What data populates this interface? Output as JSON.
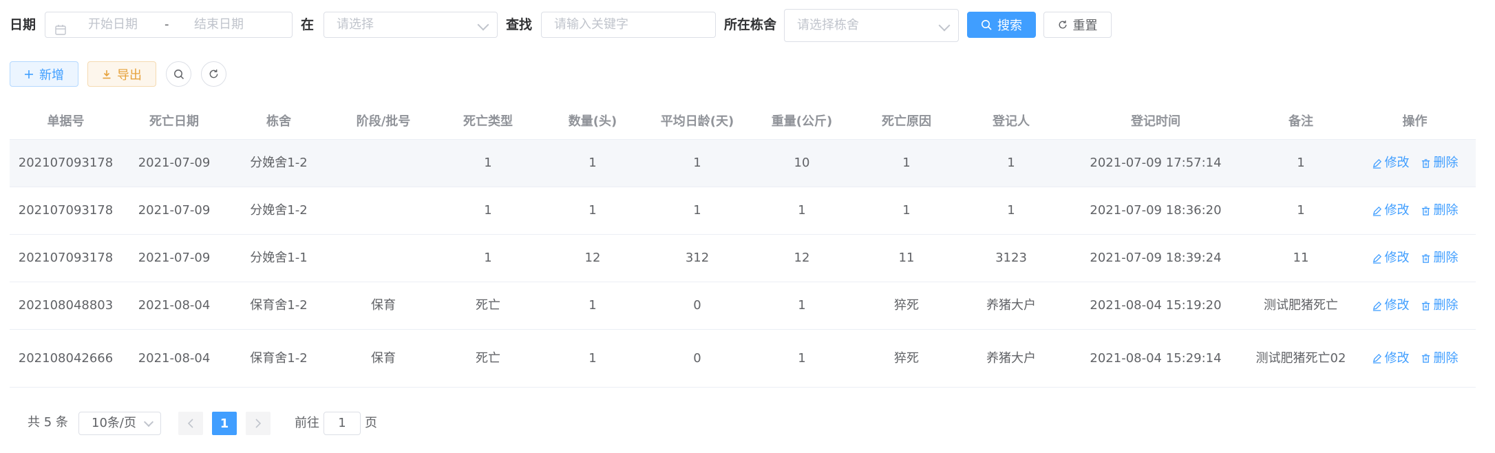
{
  "filters": {
    "date_label": "日期",
    "start_placeholder": "开始日期",
    "range_sep": "-",
    "end_placeholder": "结束日期",
    "in_label": "在",
    "select_placeholder": "请选择",
    "search_label": "查找",
    "keyword_placeholder": "请输入关键字",
    "barn_label": "所在栋舍",
    "barn_placeholder": "请选择栋舍",
    "search_button": "搜索",
    "reset_button": "重置"
  },
  "toolbar": {
    "add_button": "新增",
    "export_button": "导出"
  },
  "table": {
    "columns": [
      "单据号",
      "死亡日期",
      "栋舍",
      "阶段/批号",
      "死亡类型",
      "数量(头)",
      "平均日龄(天)",
      "重量(公斤)",
      "死亡原因",
      "登记人",
      "登记时间",
      "备注",
      "操作"
    ],
    "edit_label": "修改",
    "delete_label": "删除",
    "rows": [
      [
        "202107093178",
        "2021-07-09",
        "分娩舍1-2",
        "",
        "1",
        "1",
        "1",
        "10",
        "1",
        "1",
        "2021-07-09 17:57:14",
        "1"
      ],
      [
        "202107093178",
        "2021-07-09",
        "分娩舍1-2",
        "",
        "1",
        "1",
        "1",
        "1",
        "1",
        "1",
        "2021-07-09 18:36:20",
        "1"
      ],
      [
        "202107093178",
        "2021-07-09",
        "分娩舍1-1",
        "",
        "1",
        "12",
        "312",
        "12",
        "11",
        "3123",
        "2021-07-09 18:39:24",
        "11"
      ],
      [
        "202108048803",
        "2021-08-04",
        "保育舍1-2",
        "保育",
        "死亡",
        "1",
        "0",
        "1",
        "猝死",
        "养猪大户",
        "2021-08-04 15:19:20",
        "测试肥猪死亡"
      ],
      [
        "202108042666",
        "2021-08-04",
        "保育舍1-2",
        "保育",
        "死亡",
        "1",
        "0",
        "1",
        "猝死",
        "养猪大户",
        "2021-08-04 15:29:14",
        "测试肥猪死亡02"
      ]
    ]
  },
  "pagination": {
    "total": "共 5 条",
    "page_size": "10条/页",
    "current_page": "1",
    "goto_label": "前往",
    "goto_value": "1",
    "page_suffix": "页"
  },
  "colors": {
    "primary": "#409eff",
    "warning": "#e6a23c"
  }
}
